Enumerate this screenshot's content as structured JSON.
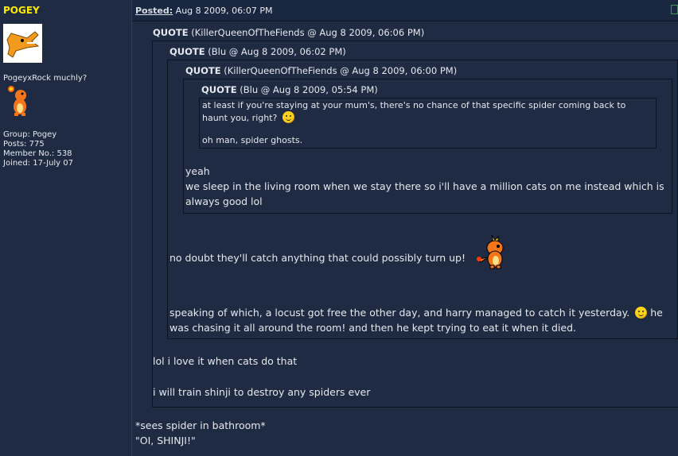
{
  "author": {
    "name": "POGEY",
    "tagline": "PogeyxRock muchly?",
    "stats": {
      "group": "Group: Pogey",
      "posts": "Posts: 775",
      "member_no": "Member No.: 538",
      "joined": "Joined: 17-July 07"
    }
  },
  "post": {
    "posted_label": "Posted:",
    "posted_date": "Aug 8 2009, 06:07 PM"
  },
  "quotes": [
    {
      "label": "QUOTE",
      "meta": "(KillerQueenOfTheFiends @ Aug 8 2009, 06:06 PM)"
    },
    {
      "label": "QUOTE",
      "meta": "(Blu @ Aug 8 2009, 06:02 PM)"
    },
    {
      "label": "QUOTE",
      "meta": "(KillerQueenOfTheFiends @ Aug 8 2009, 06:00 PM)"
    },
    {
      "label": "QUOTE",
      "meta": "(Blu @ Aug 8 2009, 05:54 PM)"
    }
  ],
  "quote4": {
    "line1": "at least if you're staying at your mum's, there's no chance of that specific spider coming back to",
    "line2": "haunt you, right?",
    "line3": "oh man, spider ghosts."
  },
  "quote3": {
    "line1": "yeah",
    "line2": "we sleep in the living room when we stay there so i'll have a million cats on me instead which is",
    "line3": "always good lol"
  },
  "quote2": {
    "line1": "no doubt they'll catch anything that could possibly turn up!",
    "line2": "speaking of which, a locust got free the other day, and harry managed to catch it yesterday.",
    "line2b": "he",
    "line3": "was chasing it all around the room! and then he kept trying to eat it when it died."
  },
  "quote1": {
    "line1": "lol i love it when cats do that",
    "line2": "i will train shinji to destroy any spiders ever"
  },
  "reply": {
    "line1": "*sees spider in bathroom*",
    "line2": "\"OI, SHINJI!\""
  },
  "icons": [
    "crocodile-avatar-icon",
    "charmander-badge-icon",
    "smiley-icon",
    "charmander-sprite-icon"
  ]
}
